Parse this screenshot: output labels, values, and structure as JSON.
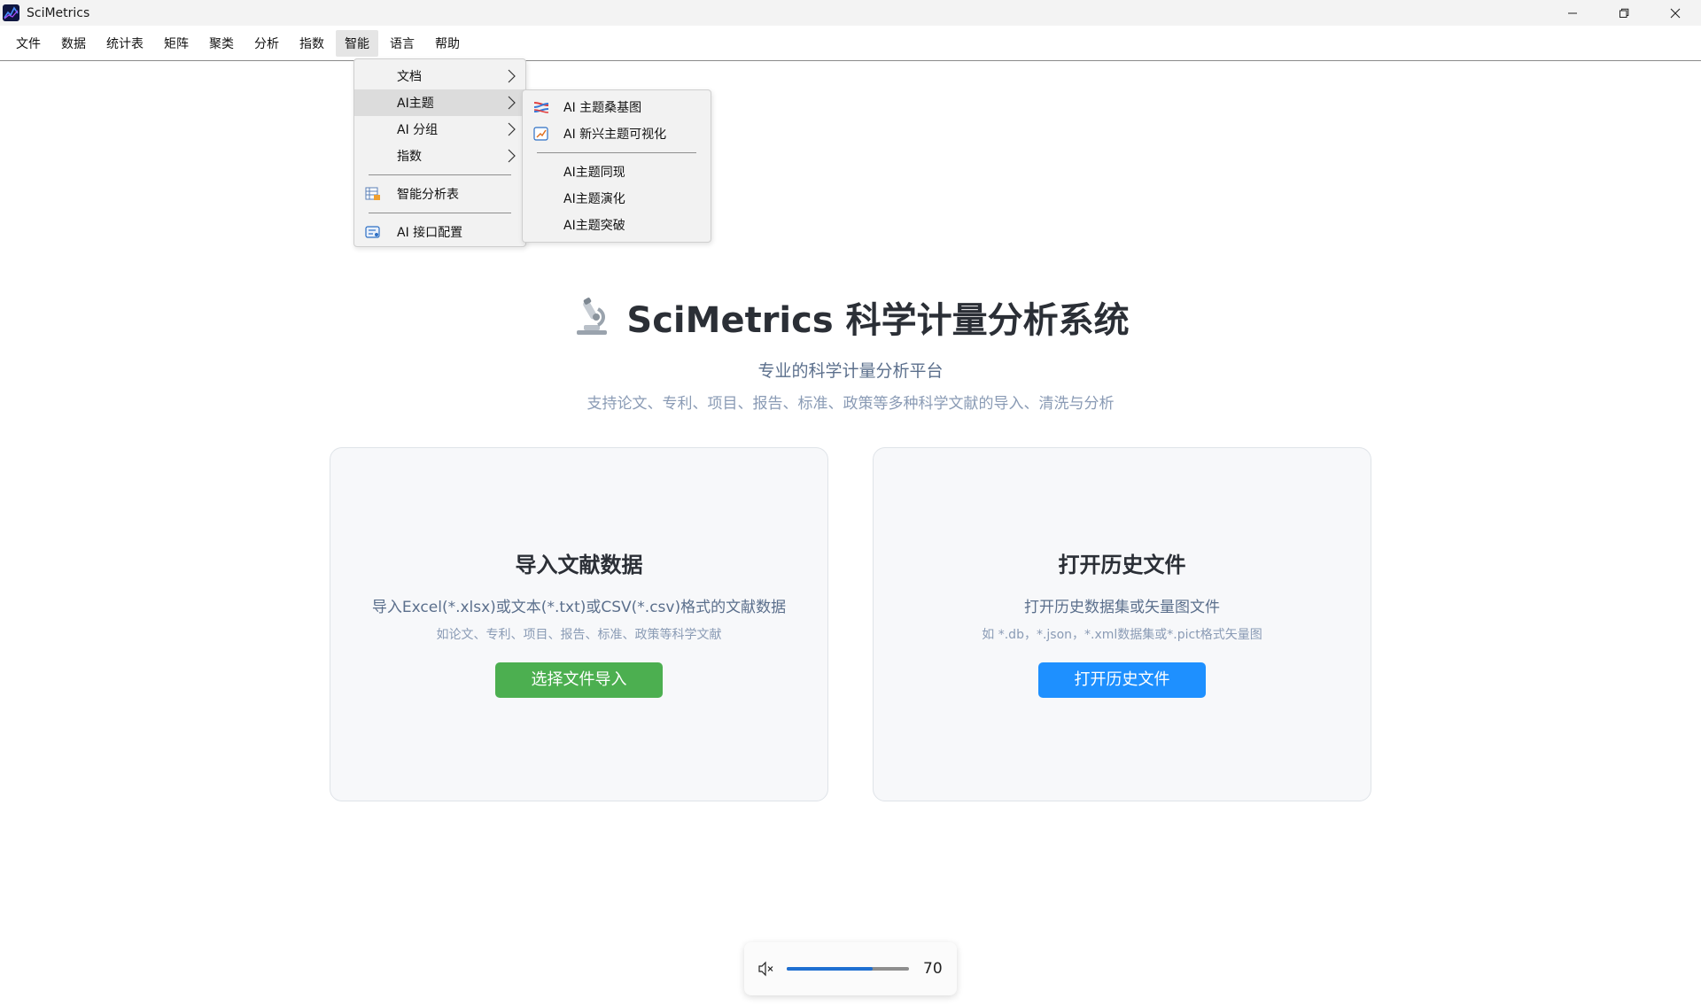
{
  "window": {
    "title": "SciMetrics",
    "controls": {
      "minimize": "—",
      "restore": "❐",
      "close": "✕"
    }
  },
  "menubar": {
    "items": [
      {
        "label": "文件"
      },
      {
        "label": "数据"
      },
      {
        "label": "统计表"
      },
      {
        "label": "矩阵"
      },
      {
        "label": "聚类"
      },
      {
        "label": "分析"
      },
      {
        "label": "指数"
      },
      {
        "label": "智能",
        "active": true
      },
      {
        "label": "语言"
      },
      {
        "label": "帮助"
      }
    ]
  },
  "smart_menu": {
    "items": {
      "document": "文档",
      "ai_topic": "AI主题",
      "ai_group": "AI 分组",
      "index": "指数",
      "smart_table": "智能分析表",
      "ai_config": "AI 接口配置"
    }
  },
  "ai_topic_submenu": {
    "items": {
      "sankey": "AI 主题桑基图",
      "emerging": "AI 新兴主题可视化",
      "cooccur": "AI主题同现",
      "evolution": "AI主题演化",
      "burst": "AI主题突破"
    }
  },
  "hero": {
    "title": "SciMetrics 科学计量分析系统",
    "subtitle": "专业的科学计量分析平台",
    "description": "支持论文、专利、项目、报告、标准、政策等多种科学文献的导入、清洗与分析"
  },
  "cards": {
    "import": {
      "title": "导入文献数据",
      "desc": "导入Excel(*.xlsx)或文本(*.txt)或CSV(*.csv)格式的文献数据",
      "note": "如论文、专利、项目、报告、标准、政策等科学文献",
      "button": "选择文件导入"
    },
    "history": {
      "title": "打开历史文件",
      "desc": "打开历史数据集或矢量图文件",
      "note": "如 *.db，*.json，*.xml数据集或*.pict格式矢量图",
      "button": "打开历史文件"
    }
  },
  "volume": {
    "value": "70",
    "level_percent": 70,
    "muted": true
  },
  "colors": {
    "accent_green": "#4caf50",
    "accent_blue": "#1e90ff",
    "slider_fill": "#1f6fd1"
  }
}
